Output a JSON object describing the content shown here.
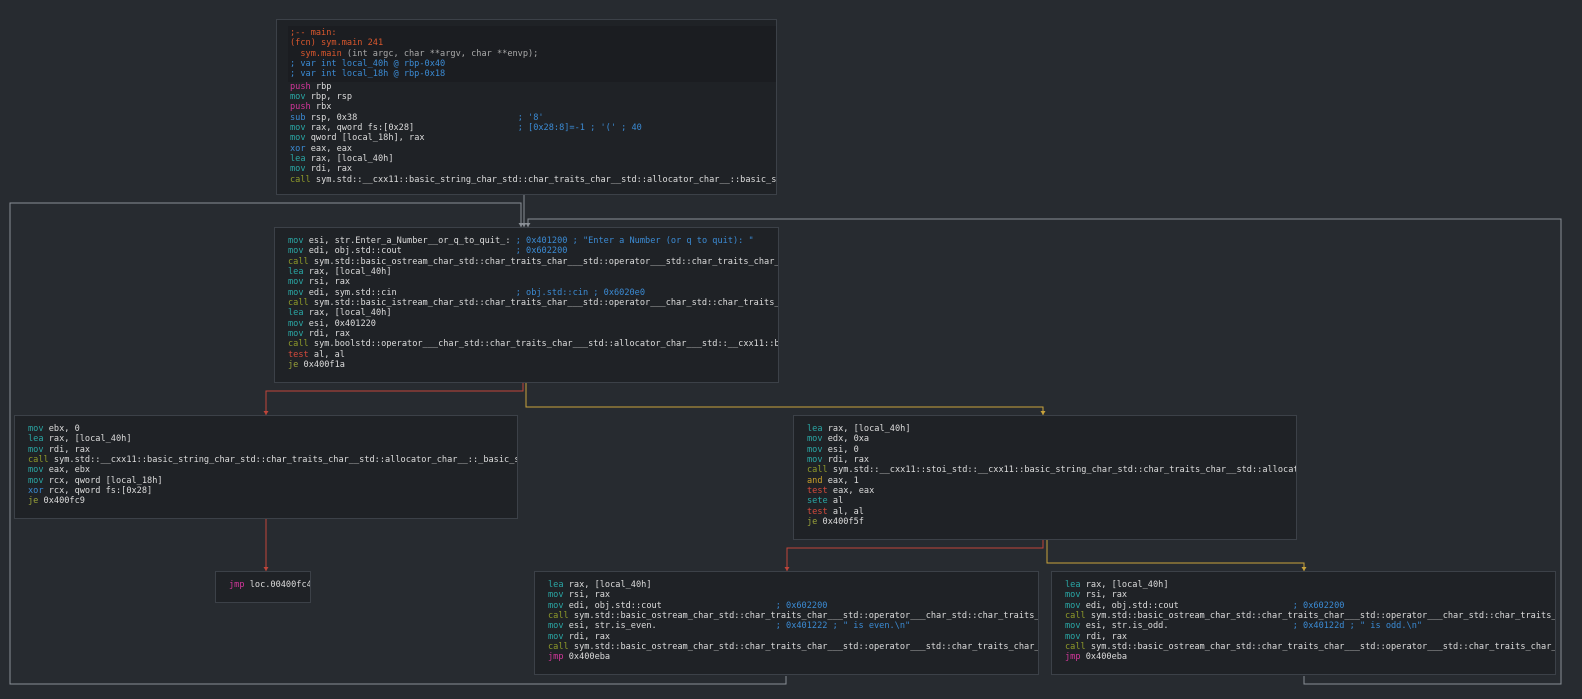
{
  "blocks": [
    {
      "id": "main",
      "header": [
        [
          {
            "t": ";-- main:",
            "c": "label"
          }
        ],
        [
          {
            "t": "(fcn) sym.main 241",
            "c": "fcn"
          }
        ],
        [
          {
            "t": "  sym.main",
            "c": "fcn"
          },
          {
            "t": " (int argc, char **argv, char **envp);",
            "c": "sig"
          }
        ],
        [
          {
            "t": "; var int local_40h @ rbp-0x40",
            "c": "hcm"
          }
        ],
        [
          {
            "t": "; var int local_18h @ rbp-0x18",
            "c": "hcm"
          }
        ]
      ],
      "lines": [
        {
          "m": "push",
          "o": "rbp",
          "c": ""
        },
        {
          "m": "mov",
          "o": "rbp, rsp",
          "c": ""
        },
        {
          "m": "push",
          "o": "rbx",
          "c": ""
        },
        {
          "m": "sub",
          "o": "rsp, 0x38",
          "c": "; '8'"
        },
        {
          "m": "mov",
          "o": "rax, qword fs:[0x28]",
          "c": "; [0x28:8]=-1 ; '(' ; 40"
        },
        {
          "m": "mov",
          "o": "qword [local_18h], rax",
          "c": ""
        },
        {
          "m": "xor",
          "o": "eax, eax",
          "c": ""
        },
        {
          "m": "lea",
          "o": "rax, [local_40h]",
          "c": ""
        },
        {
          "m": "mov",
          "o": "rdi, rax",
          "c": ""
        },
        {
          "m": "call",
          "o": "sym.std::__cxx11::basic_string_char_std::char_traits_char__std::allocator_char__::basic_string",
          "c": ""
        }
      ]
    },
    {
      "id": "loop",
      "lines": [
        {
          "m": "mov",
          "o": "esi, str.Enter_a_Number__or_q_to_quit_:",
          "c": "; 0x401200 ; \"Enter a Number (or q to quit): \""
        },
        {
          "m": "mov",
          "o": "edi, obj.std::cout",
          "c": "; 0x602200"
        },
        {
          "m": "call",
          "o": "sym.std::basic_ostream_char_std::char_traits_char___std::operator___std::char_traits_char___...",
          "c": ""
        },
        {
          "m": "lea",
          "o": "rax, [local_40h]",
          "c": ""
        },
        {
          "m": "mov",
          "o": "rsi, rax",
          "c": ""
        },
        {
          "m": "mov",
          "o": "edi, sym.std::cin",
          "c": "; obj.std::cin ; 0x6020e0"
        },
        {
          "m": "call",
          "o": "sym.std::basic_istream_char_std::char_traits_char___std::operator___char_std::char_traits_ch...",
          "c": ""
        },
        {
          "m": "lea",
          "o": "rax, [local_40h]",
          "c": ""
        },
        {
          "m": "mov",
          "o": "esi, 0x401220",
          "c": ""
        },
        {
          "m": "mov",
          "o": "rdi, rax",
          "c": ""
        },
        {
          "m": "call",
          "o": "sym.boolstd::operator___char_std::char_traits_char___std::allocator_char___std::__cxx11::basi...",
          "c": ""
        },
        {
          "m": "test",
          "o": "al, al",
          "c": ""
        },
        {
          "m": "je",
          "o": "0x400f1a",
          "c": ""
        }
      ]
    },
    {
      "id": "quit",
      "lines": [
        {
          "m": "mov",
          "o": "ebx, 0",
          "c": ""
        },
        {
          "m": "lea",
          "o": "rax, [local_40h]",
          "c": ""
        },
        {
          "m": "mov",
          "o": "rdi, rax",
          "c": ""
        },
        {
          "m": "call",
          "o": "sym.std::__cxx11::basic_string_char_std::char_traits_char__std::allocator_char__::_basic_string",
          "c": ""
        },
        {
          "m": "mov",
          "o": "eax, ebx",
          "c": ""
        },
        {
          "m": "mov",
          "o": "rcx, qword [local_18h]",
          "c": ""
        },
        {
          "m": "xor",
          "o": "rcx, qword fs:[0x28]",
          "c": ""
        },
        {
          "m": "je",
          "o": "0x400fc9",
          "c": ""
        }
      ]
    },
    {
      "id": "parse",
      "lines": [
        {
          "m": "lea",
          "o": "rax, [local_40h]",
          "c": ""
        },
        {
          "m": "mov",
          "o": "edx, 0xa",
          "c": ""
        },
        {
          "m": "mov",
          "o": "esi, 0",
          "c": ""
        },
        {
          "m": "mov",
          "o": "rdi, rax",
          "c": ""
        },
        {
          "m": "call",
          "o": "sym.std::__cxx11::stoi_std::__cxx11::basic_string_char_std::char_traits_char__std::allocator...",
          "c": ""
        },
        {
          "m": "and",
          "o": "eax, 1",
          "c": ""
        },
        {
          "m": "test",
          "o": "eax, eax",
          "c": ""
        },
        {
          "m": "sete",
          "o": "al",
          "c": ""
        },
        {
          "m": "test",
          "o": "al, al",
          "c": ""
        },
        {
          "m": "je",
          "o": "0x400f5f",
          "c": ""
        }
      ]
    },
    {
      "id": "jmpfc4",
      "lines": [
        {
          "m": "jmp",
          "o": "loc.00400fc4",
          "c": ""
        }
      ]
    },
    {
      "id": "even",
      "lines": [
        {
          "m": "lea",
          "o": "rax, [local_40h]",
          "c": ""
        },
        {
          "m": "mov",
          "o": "rsi, rax",
          "c": ""
        },
        {
          "m": "mov",
          "o": "edi, obj.std::cout",
          "c": "; 0x602200"
        },
        {
          "m": "call",
          "o": "sym.std::basic_ostream_char_std::char_traits_char___std::operator___char_std::char_traits_ch...",
          "c": ""
        },
        {
          "m": "mov",
          "o": "esi, str.is_even.",
          "c": "; 0x401222 ; \" is even.\\n\""
        },
        {
          "m": "mov",
          "o": "rdi, rax",
          "c": ""
        },
        {
          "m": "call",
          "o": "sym.std::basic_ostream_char_std::char_traits_char___std::operator___std::char_traits_char___...",
          "c": ""
        },
        {
          "m": "jmp",
          "o": "0x400eba",
          "c": ""
        }
      ]
    },
    {
      "id": "odd",
      "lines": [
        {
          "m": "lea",
          "o": "rax, [local_40h]",
          "c": ""
        },
        {
          "m": "mov",
          "o": "rsi, rax",
          "c": ""
        },
        {
          "m": "mov",
          "o": "edi, obj.std::cout",
          "c": "; 0x602200"
        },
        {
          "m": "call",
          "o": "sym.std::basic_ostream_char_std::char_traits_char___std::operator___char_std::char_traits_ch...",
          "c": ""
        },
        {
          "m": "mov",
          "o": "esi, str.is_odd.",
          "c": "; 0x40122d ; \" is odd.\\n\""
        },
        {
          "m": "mov",
          "o": "rdi, rax",
          "c": ""
        },
        {
          "m": "call",
          "o": "sym.std::basic_ostream_char_std::char_traits_char___std::operator___std::char_traits_char___...",
          "c": ""
        },
        {
          "m": "jmp",
          "o": "0x400eba",
          "c": ""
        }
      ]
    }
  ],
  "colors": {
    "background": "#272b30",
    "block_bg": "#1f2226",
    "edge_default": "#8a8f96",
    "edge_true": "#c9a33b",
    "edge_false": "#c0453a"
  }
}
